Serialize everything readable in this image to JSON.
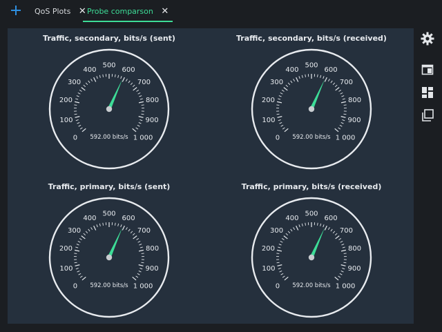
{
  "tabbar": {
    "add_icon": "plus-icon",
    "tabs": [
      {
        "label": "QoS Plots",
        "active": false
      },
      {
        "label": "Probe comparson",
        "active": true
      }
    ]
  },
  "gauges": [
    {
      "title": "Traffic, secondary, bits/s (sent)",
      "value": 592.0,
      "readout": "592.00 bits/s"
    },
    {
      "title": "Traffic, secondary, bits/s (received)",
      "value": 592.0,
      "readout": "592.00 bits/s"
    },
    {
      "title": "Traffic, primary, bits/s (sent)",
      "value": 592.0,
      "readout": "592.00 bits/s"
    },
    {
      "title": "Traffic, primary, bits/s (received)",
      "value": 592.0,
      "readout": "592.00 bits/s"
    }
  ],
  "scale": {
    "min": 0,
    "max": 1000,
    "major_labels": [
      "0",
      "100",
      "200",
      "300",
      "400",
      "500",
      "600",
      "700",
      "800",
      "900",
      "1 000"
    ]
  },
  "colors": {
    "background": "#1b1e22",
    "panel": "#25303d",
    "needle": "#3ddc97",
    "ring": "#e8ebef",
    "accent_tab": "#3ddc97",
    "add": "#2e8fe0"
  },
  "toolbar": {
    "icons": [
      "gear-icon",
      "panel-window-icon",
      "dashboard-layout-icon",
      "copy-window-icon"
    ]
  }
}
